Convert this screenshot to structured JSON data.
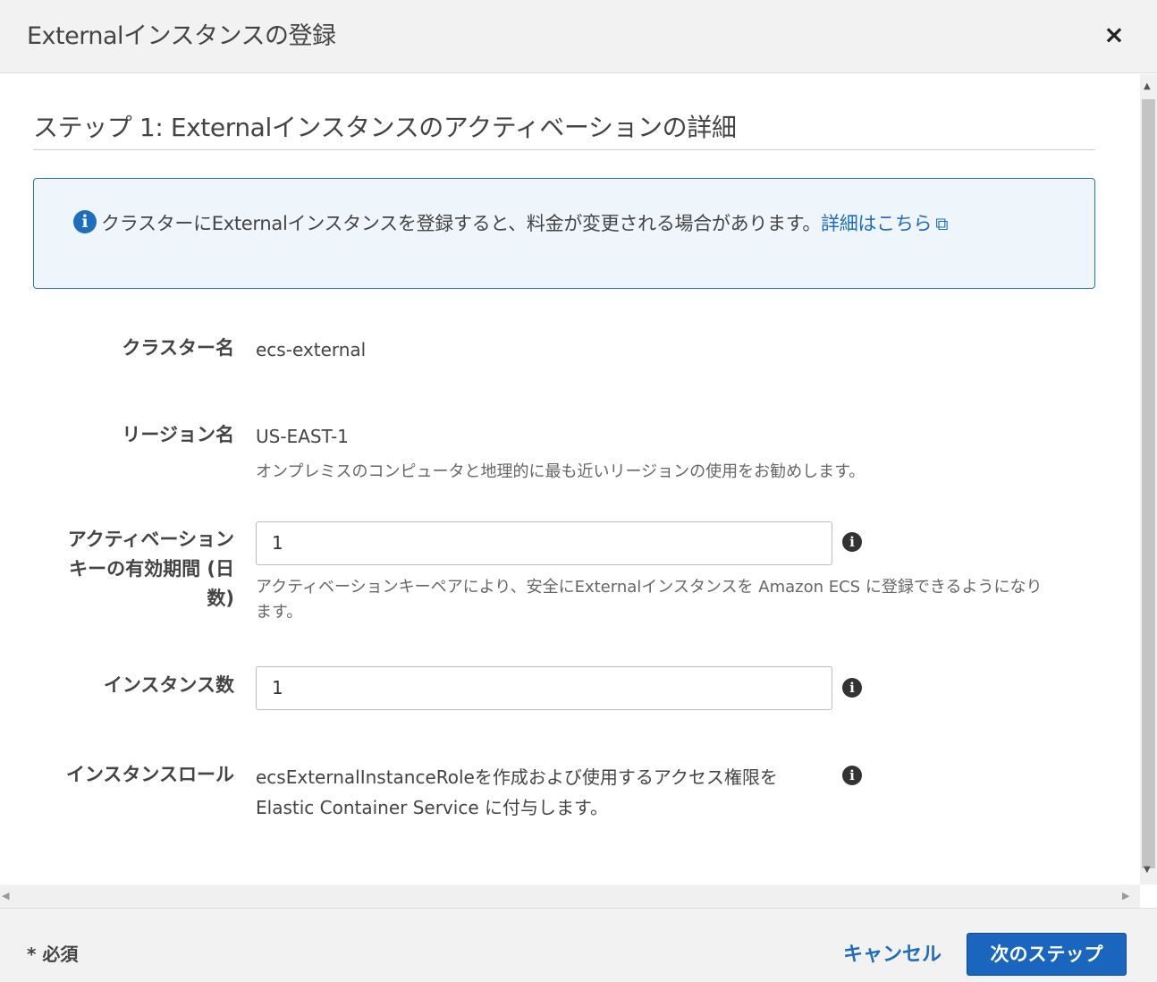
{
  "modal": {
    "title": "Externalインスタンスの登録",
    "close_icon": "×"
  },
  "step": {
    "title": "ステップ 1: Externalインスタンスのアクティベーションの詳細"
  },
  "info_box": {
    "icon": "info-circle-icon",
    "text": "クラスターにExternalインスタンスを登録すると、料金が変更される場合があります。",
    "link_label": "詳細はこちら",
    "link_icon": "external-link-icon"
  },
  "form": {
    "cluster": {
      "label": "クラスター名",
      "value": "ecs-external"
    },
    "region": {
      "label": "リージョン名",
      "value": "US-EAST-1",
      "hint": "オンプレミスのコンピュータと地理的に最も近いリージョンの使用をお勧めします。"
    },
    "activation": {
      "label_line1": "アクティベーション",
      "label_line2": "キーの有効期間 (日",
      "label_line3": "数)",
      "value": "1",
      "hint_line1": "アクティベーションキーペアにより、安全にExternalインスタンスを Amazon ECS に登録できるようになり",
      "hint_line2": "ます。"
    },
    "instance_count": {
      "label": "インスタンス数",
      "value": "1"
    },
    "instance_role": {
      "label": "インスタンスロール",
      "text_line1": "ecsExternalInstanceRoleを作成および使用するアクセス権限を",
      "text_line2": "Elastic Container Service に付与します。"
    }
  },
  "footer": {
    "required": "* 必須",
    "cancel_label": "キャンセル",
    "next_label": "次のステップ"
  },
  "colors": {
    "accent": "#1f6dbd",
    "info_bg": "#eef6fc",
    "primary_button": "#1a66bf"
  }
}
